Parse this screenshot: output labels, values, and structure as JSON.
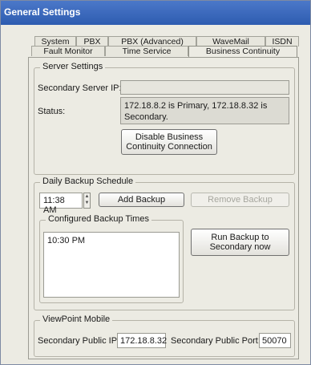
{
  "window": {
    "title": "General Settings"
  },
  "tabs": {
    "row1": [
      "System",
      "PBX",
      "PBX (Advanced)",
      "WaveMail",
      "ISDN"
    ],
    "row2": [
      "Fault Monitor",
      "Time Service",
      "Business Continuity"
    ],
    "active": "Business Continuity"
  },
  "server_settings": {
    "legend": "Server Settings",
    "secondary_ip_label": "Secondary Server IP:",
    "secondary_ip_value": "",
    "status_label": "Status:",
    "status_text": "172.18.8.2 is Primary, 172.18.8.32 is Secondary.",
    "disable_button": "Disable Business Continuity Connection"
  },
  "backup": {
    "legend": "Daily Backup Schedule",
    "time_value": "11:38 AM",
    "add_button": "Add Backup",
    "remove_button": "Remove Backup",
    "configured_legend": "Configured Backup Times",
    "times": [
      "10:30 PM"
    ],
    "run_button": "Run Backup to Secondary now"
  },
  "viewpoint": {
    "legend": "ViewPoint Mobile",
    "public_ip_label": "Secondary Public IP:",
    "public_ip_value": "172.18.8.32",
    "public_port_label": "Secondary Public Port:",
    "public_port_value": "50070"
  }
}
